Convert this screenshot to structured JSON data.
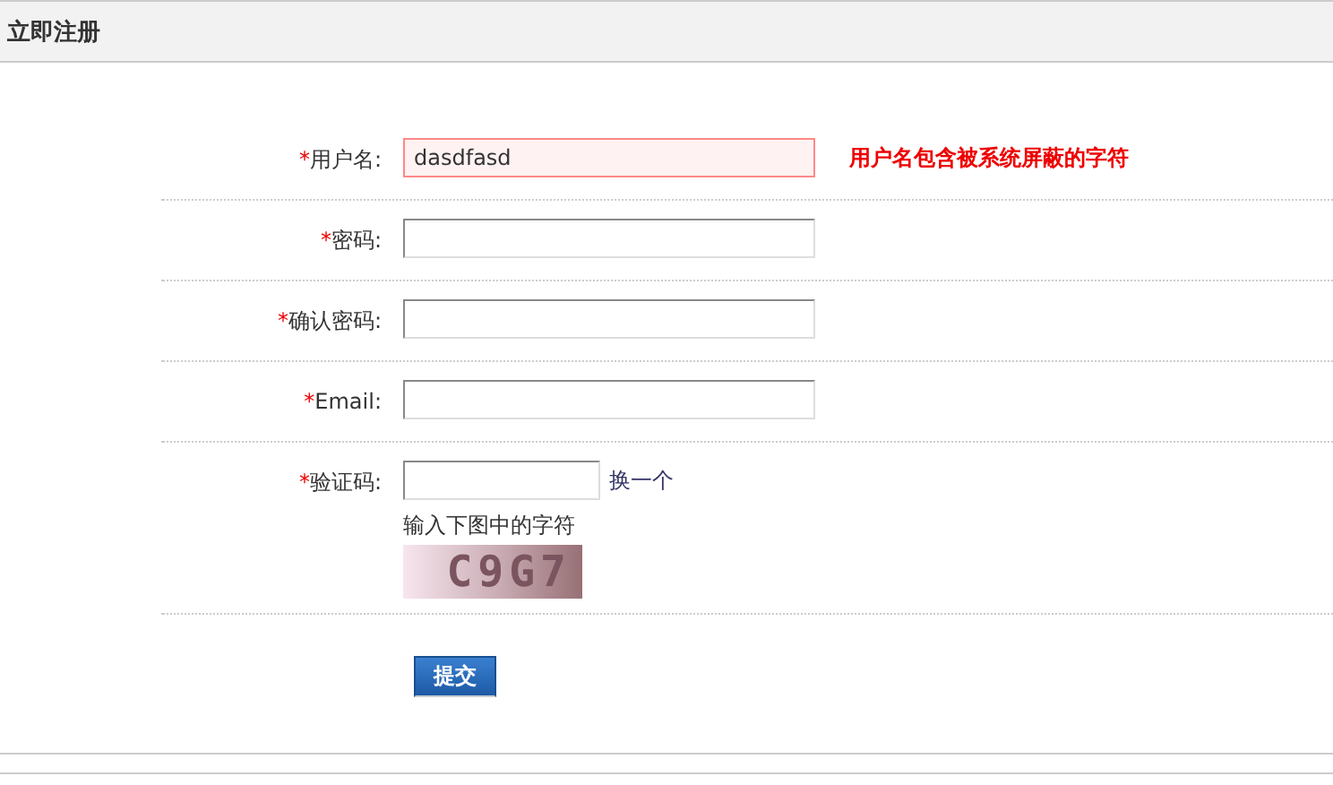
{
  "header": {
    "title": "立即注册"
  },
  "fields": [
    {
      "kind": "text",
      "required_mark": "*",
      "label": "用户名:",
      "value": "dasdfasd",
      "error": true,
      "message": "用户名包含被系统屏蔽的字符"
    },
    {
      "kind": "text",
      "required_mark": "*",
      "label": "密码:",
      "error": false
    },
    {
      "kind": "text",
      "required_mark": "*",
      "label": "确认密码:",
      "error": false
    },
    {
      "kind": "text",
      "required_mark": "*",
      "label": "Email:",
      "error": false
    },
    {
      "kind": "captcha",
      "required_mark": "*",
      "label": "验证码:",
      "error": false,
      "refresh_link": "换一个",
      "hint": "输入下图中的字符",
      "captcha_text": "C9G7"
    }
  ],
  "submit": {
    "label": "提交"
  }
}
